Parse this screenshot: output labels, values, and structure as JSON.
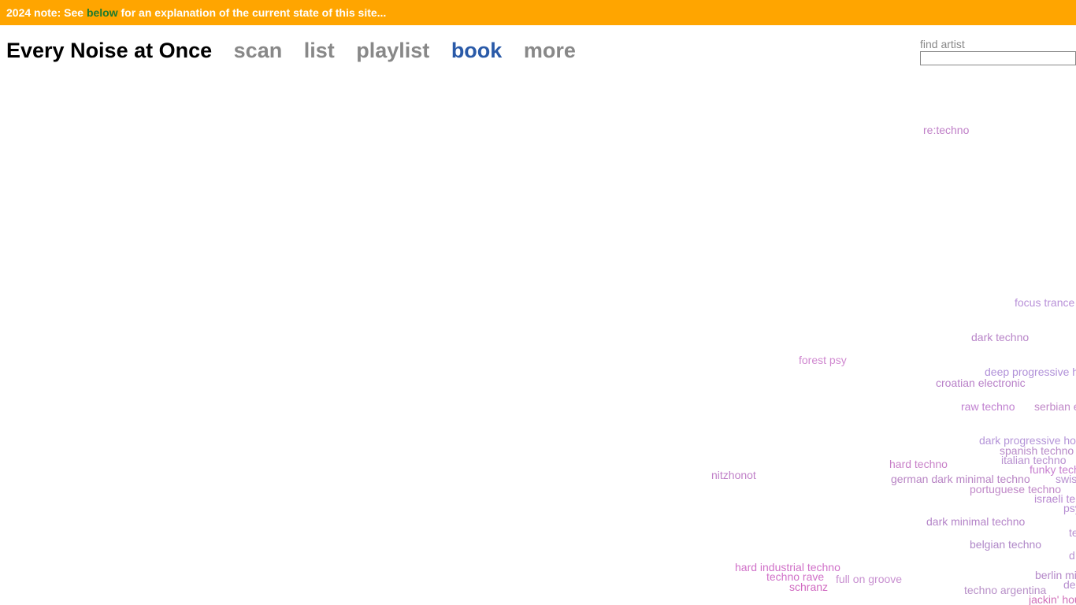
{
  "notice": {
    "prefix": "2024 note: See ",
    "link": "below",
    "suffix": " for an explanation of the current state of this site..."
  },
  "nav": {
    "title": "Every Noise at Once",
    "links": [
      "scan",
      "list",
      "playlist",
      "book",
      "more"
    ],
    "active": "book"
  },
  "search": {
    "label": "find artist",
    "value": ""
  },
  "colors": {
    "notice_bg": "#ffa500",
    "notice_link": "#1e7b2e",
    "nav_inactive": "#888888",
    "nav_active": "#2a5aa8"
  },
  "genres": [
    {
      "name": "re:techno",
      "color": "#c080c8"
    },
    {
      "name": "focus trance",
      "color": "#b890d8"
    },
    {
      "name": "dark techno",
      "color": "#b884c8"
    },
    {
      "name": "forest psy",
      "color": "#d088d0"
    },
    {
      "name": "deep progressive h",
      "color": "#b090d8"
    },
    {
      "name": "croatian electronic",
      "color": "#b880c8"
    },
    {
      "name": "raw techno",
      "color": "#c080d0"
    },
    {
      "name": "serbian e",
      "color": "#c088c8"
    },
    {
      "name": "dark progressive ho",
      "color": "#b494d8"
    },
    {
      "name": "spanish techno",
      "color": "#b88ac8"
    },
    {
      "name": "italian techno",
      "color": "#b890d0"
    },
    {
      "name": "hard techno",
      "color": "#c880c8"
    },
    {
      "name": "funky tech",
      "color": "#c880d0"
    },
    {
      "name": "nitzhonot",
      "color": "#c080c8"
    },
    {
      "name": "german dark minimal techno",
      "color": "#b884c4"
    },
    {
      "name": "swis",
      "color": "#b890d0"
    },
    {
      "name": "portuguese techno",
      "color": "#c088c8"
    },
    {
      "name": "israeli te",
      "color": "#b888d0"
    },
    {
      "name": "psy",
      "color": "#b890d4"
    },
    {
      "name": "dark minimal techno",
      "color": "#b484c8"
    },
    {
      "name": "te",
      "color": "#b890d0"
    },
    {
      "name": "belgian techno",
      "color": "#b088c8"
    },
    {
      "name": "d",
      "color": "#b890d0"
    },
    {
      "name": "hard industrial techno",
      "color": "#d070c8"
    },
    {
      "name": "techno rave",
      "color": "#d070c8"
    },
    {
      "name": "full on groove",
      "color": "#c890d0"
    },
    {
      "name": "berlin mi",
      "color": "#b488c8"
    },
    {
      "name": "schranz",
      "color": "#d068c0"
    },
    {
      "name": "de",
      "color": "#b890d0"
    },
    {
      "name": "techno argentina",
      "color": "#b890c8"
    },
    {
      "name": "jackin' hou",
      "color": "#d070b8"
    }
  ]
}
